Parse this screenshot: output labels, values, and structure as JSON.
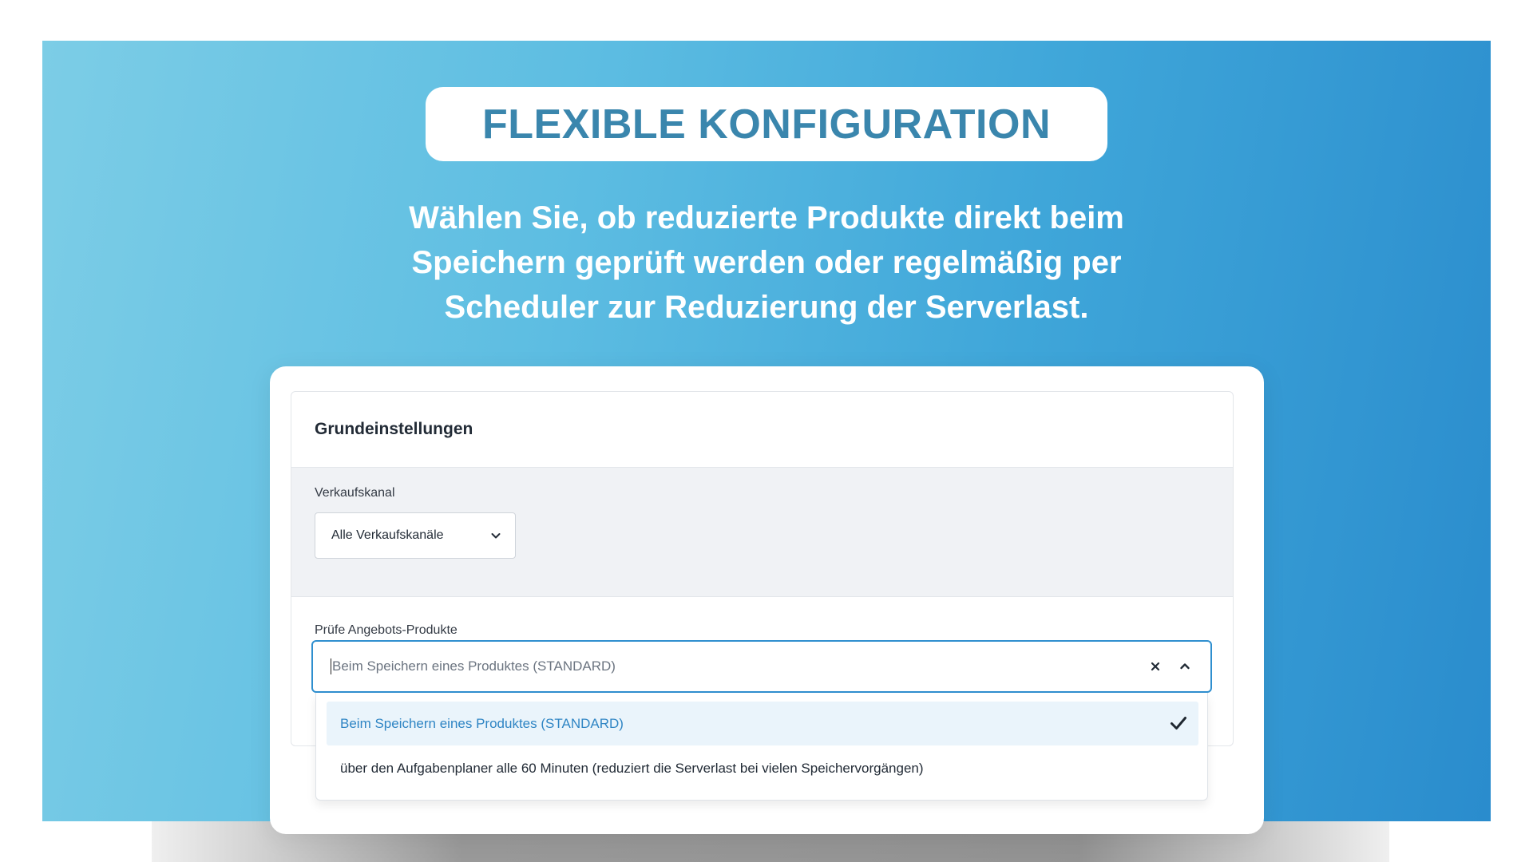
{
  "hero": {
    "title": "FLEXIBLE KONFIGURATION",
    "subtitle": "Wählen Sie, ob reduzierte Produkte direkt beim Speichern geprüft werden oder regelmäßig per Scheduler zur Reduzierung der Serverlast."
  },
  "panel": {
    "header": "Grundeinstellungen",
    "sales_channel": {
      "label": "Verkaufskanal",
      "value": "Alle Verkaufskanäle"
    },
    "check_products": {
      "label": "Prüfe Angebots-Produkte",
      "placeholder": "Beim Speichern eines Produktes (STANDARD)",
      "options": [
        {
          "label": "Beim Speichern eines Produktes (STANDARD)",
          "selected": true
        },
        {
          "label": "über den Aufgabenplaner alle 60 Minuten (reduziert die Serverlast bei vielen Speichervorgängen)",
          "selected": false
        }
      ]
    }
  },
  "colors": {
    "title": "#3a86ad",
    "accent": "#2f8fcf",
    "selected_bg": "#eaf4fb"
  },
  "icons": {
    "select_toggle": "chevron-down-icon",
    "clear": "close-icon",
    "collapse": "chevron-up-icon",
    "selected_mark": "checkmark-icon"
  }
}
